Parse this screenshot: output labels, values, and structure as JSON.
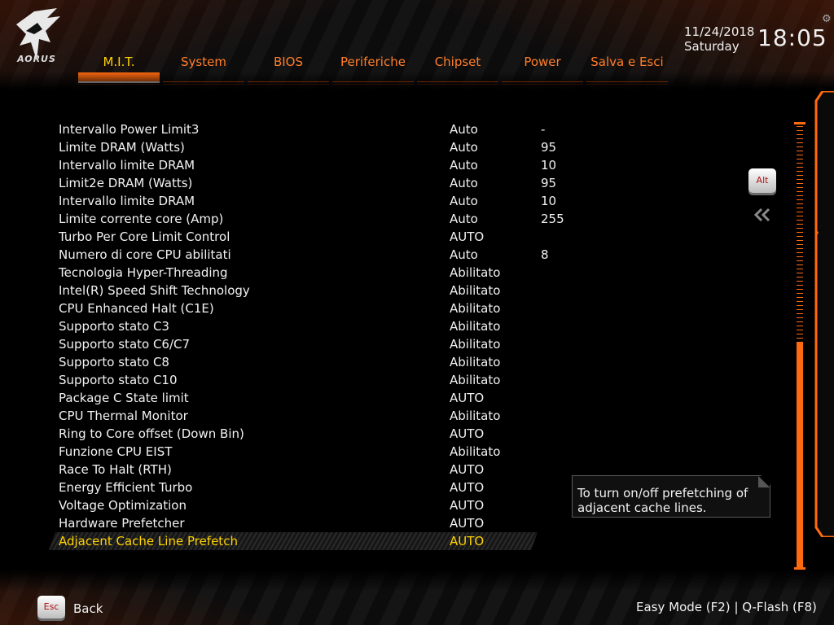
{
  "brand": {
    "logo_text": "AORUS"
  },
  "tabs": [
    {
      "label": "M.I.T.",
      "active": true
    },
    {
      "label": "System"
    },
    {
      "label": "BIOS"
    },
    {
      "label": "Periferiche"
    },
    {
      "label": "Chipset"
    },
    {
      "label": "Power"
    },
    {
      "label": "Salva e Esci"
    }
  ],
  "clock": {
    "date": "11/24/2018",
    "day": "Saturday",
    "time": "18:05"
  },
  "settings": [
    {
      "label": "Intervallo Power Limit3",
      "value": "Auto",
      "number": "-"
    },
    {
      "label": "Limite DRAM (Watts)",
      "value": "Auto",
      "number": "95"
    },
    {
      "label": "Intervallo limite DRAM",
      "value": "Auto",
      "number": "10"
    },
    {
      "label": "Limit2e DRAM (Watts)",
      "value": "Auto",
      "number": "95"
    },
    {
      "label": "Intervallo limite DRAM",
      "value": "Auto",
      "number": "10"
    },
    {
      "label": "Limite corrente core (Amp)",
      "value": "Auto",
      "number": "255"
    },
    {
      "label": "Turbo Per Core Limit Control",
      "value": "AUTO",
      "number": ""
    },
    {
      "label": "Numero di core CPU abilitati",
      "value": "Auto",
      "number": "8"
    },
    {
      "label": "Tecnologia Hyper-Threading",
      "value": "Abilitato",
      "number": ""
    },
    {
      "label": "Intel(R) Speed Shift Technology",
      "value": "Abilitato",
      "number": ""
    },
    {
      "label": "CPU Enhanced Halt (C1E)",
      "value": "Abilitato",
      "number": ""
    },
    {
      "label": "Supporto stato C3",
      "value": "Abilitato",
      "number": ""
    },
    {
      "label": "Supporto stato C6/C7",
      "value": "Abilitato",
      "number": ""
    },
    {
      "label": "Supporto stato C8",
      "value": "Abilitato",
      "number": ""
    },
    {
      "label": "Supporto stato C10",
      "value": "Abilitato",
      "number": ""
    },
    {
      "label": "Package C State limit",
      "value": "AUTO",
      "number": ""
    },
    {
      "label": "CPU Thermal Monitor",
      "value": "Abilitato",
      "number": ""
    },
    {
      "label": "Ring to Core offset (Down Bin)",
      "value": "AUTO",
      "number": ""
    },
    {
      "label": "Funzione CPU EIST",
      "value": "Abilitato",
      "number": ""
    },
    {
      "label": "Race To Halt (RTH)",
      "value": "AUTO",
      "number": ""
    },
    {
      "label": "Energy Efficient Turbo",
      "value": "AUTO",
      "number": ""
    },
    {
      "label": "Voltage Optimization",
      "value": "AUTO",
      "number": ""
    },
    {
      "label": "Hardware Prefetcher",
      "value": "AUTO",
      "number": ""
    },
    {
      "label": "Adjacent Cache Line Prefetch",
      "value": "AUTO",
      "number": "",
      "selected": true
    }
  ],
  "tooltip": {
    "line1": "To turn on/off prefetching of",
    "line2": "adjacent cache lines."
  },
  "keys": {
    "alt": "Alt",
    "esc": "Esc"
  },
  "footer": {
    "back": "Back",
    "easy_mode": "Easy Mode (F2)",
    "separator": "|",
    "qflash": "Q-Flash (F8)"
  },
  "colors": {
    "accent": "#ff6a10",
    "selected_text": "#ffd200",
    "tab_text": "#ff7e2a"
  }
}
